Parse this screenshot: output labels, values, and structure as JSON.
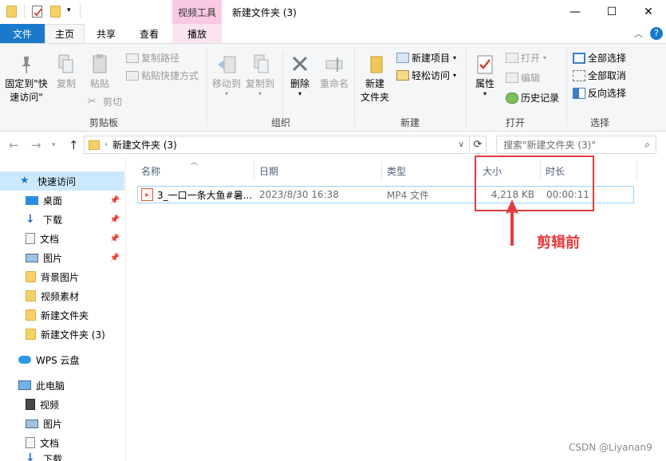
{
  "window": {
    "title": "新建文件夹 (3)",
    "context_tab_header": "视频工具",
    "controls": {
      "minimize": "—",
      "maximize": "☐",
      "close": "✕"
    }
  },
  "tabs": {
    "file": "文件",
    "home": "主页",
    "share": "共享",
    "view": "查看",
    "play": "播放"
  },
  "ribbon": {
    "clipboard": {
      "pin": "固定到\"快速访问\"",
      "copy": "复制",
      "paste": "粘贴",
      "copy_path": "复制路径",
      "paste_shortcut": "粘贴快捷方式",
      "cut": "剪切",
      "label": "剪贴板"
    },
    "organize": {
      "move_to": "移动到",
      "copy_to": "复制到",
      "delete": "删除",
      "rename": "重命名",
      "label": "组织"
    },
    "new": {
      "new_folder": "新建\n文件夹",
      "new_item": "新建项目",
      "easy_access": "轻松访问",
      "label": "新建"
    },
    "open": {
      "properties": "属性",
      "open": "打开",
      "edit": "编辑",
      "history": "历史记录",
      "label": "打开"
    },
    "select": {
      "select_all": "全部选择",
      "select_none": "全部取消",
      "invert": "反向选择",
      "label": "选择"
    }
  },
  "address": {
    "path": "新建文件夹 (3)",
    "search_placeholder": "搜索\"新建文件夹 (3)\""
  },
  "nav": {
    "quick_access": "快速访问",
    "items": [
      {
        "label": "桌面",
        "icon": "desktop-icon",
        "pinned": true
      },
      {
        "label": "下载",
        "icon": "download-icon",
        "pinned": true
      },
      {
        "label": "文档",
        "icon": "document-icon",
        "pinned": true
      },
      {
        "label": "图片",
        "icon": "picture-icon",
        "pinned": true
      },
      {
        "label": "背景图片",
        "icon": "folder-icon",
        "pinned": false
      },
      {
        "label": "视频素材",
        "icon": "folder-icon",
        "pinned": false
      },
      {
        "label": "新建文件夹",
        "icon": "folder-icon",
        "pinned": false
      },
      {
        "label": "新建文件夹 (3)",
        "icon": "folder-icon",
        "pinned": false
      }
    ],
    "wps": "WPS 云盘",
    "this_pc": "此电脑",
    "pc_items": [
      {
        "label": "视频",
        "icon": "video-icon"
      },
      {
        "label": "图片",
        "icon": "picture-icon"
      },
      {
        "label": "文档",
        "icon": "document-icon"
      },
      {
        "label": "下载",
        "icon": "download-icon"
      }
    ]
  },
  "columns": {
    "name": "名称",
    "date": "日期",
    "type": "类型",
    "size": "大小",
    "duration": "时长"
  },
  "files": [
    {
      "name": "3_一口一条大鱼#暑...",
      "date": "2023/8/30 16:38",
      "type": "MP4 文件",
      "size": "4,218 KB",
      "duration": "00:00:11"
    }
  ],
  "annotation": {
    "label": "剪辑前",
    "color": "#e53b3b"
  },
  "watermark": "CSDN @Liyanan9",
  "colors": {
    "file_tab": "#1979ca",
    "context_tab": "#f8c9e3",
    "selection": "#cce8ff",
    "row_border": "#99d1ff"
  }
}
